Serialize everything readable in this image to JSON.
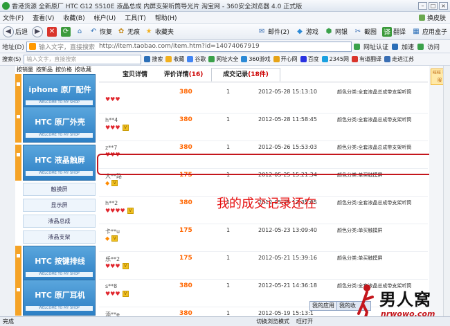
{
  "window": {
    "title": "香港货源 全新原厂 HTC G12 S510E 液晶总成 内屏支架听筒导光片 淘宝网 - 360安全浏览器 4.0 正式版",
    "minimize": "–",
    "maximize": "□",
    "close": "×"
  },
  "menu": {
    "items": [
      "文件(F)",
      "查看(V)",
      "收藏(B)",
      "帐户(U)",
      "工具(T)",
      "帮助(H)"
    ],
    "skin": "换皮肤"
  },
  "toolbar": {
    "back": "后退",
    "restore": "恢复",
    "favorites_none": "无痕",
    "favorites": "收藏夹",
    "mail": "邮件(2)",
    "games": "游戏",
    "netbank": "网银",
    "screenshot": "截图",
    "translate": "翻译",
    "apps": "应用盒子"
  },
  "address": {
    "label": "地址(D)",
    "placeholder": "输入文字，直接搜索",
    "url": "http://item.taobao.com/item.htm?id=14074067919",
    "site_id": "网址认证",
    "speed": "加速",
    "go": "访问"
  },
  "favbar": {
    "label": "搜索(S)",
    "search_btn": "搜索",
    "favs": "收藏",
    "items": [
      "谷歌",
      "网址大全",
      "360游戏",
      "开心网",
      "百度",
      "2345网",
      "有道翻译",
      "走进江苏"
    ]
  },
  "content": {
    "subnav": [
      "按销量",
      "按新品",
      "按价格",
      "按收藏"
    ],
    "categories": [
      {
        "name": "iphone 原厂配件",
        "strip": "WELCOME TO MY SHOP"
      },
      {
        "name": "HTC 原厂外壳",
        "strip": "WELCOME TO MY SHOP"
      },
      {
        "name": "HTC 液晶触屏",
        "strip": "WELCOME TO MY SHOP"
      },
      {
        "name": "HTC 按键排线",
        "strip": "WELCOME TO MY SHOP"
      },
      {
        "name": "HTC 原厂耳机",
        "strip": "WELCOME TO MY SHOP"
      }
    ],
    "subitems": [
      "触摸屏",
      "显示屏",
      "液晶总成",
      "液晶支架"
    ],
    "tabs": {
      "detail": "宝贝详情",
      "reviews": "评价详情",
      "reviews_count": "(16)",
      "records": "成交记录",
      "records_count": "(18件)"
    },
    "records": [
      {
        "buyer": "",
        "price": "380",
        "qty": "1",
        "time": "2012-05-28 15:13:10",
        "spec": "颜色分类:全套液晶总成带支架听筒"
      },
      {
        "buyer": "h**4",
        "price": "380",
        "qty": "1",
        "time": "2012-05-28 11:58:45",
        "spec": "颜色分类:全套液晶总成带支架听筒"
      },
      {
        "buyer": "z**7",
        "price": "380",
        "qty": "1",
        "time": "2012-05-26 15:53:03",
        "spec": "颜色分类:全套液晶总成带支架听筒"
      },
      {
        "buyer": "大**路",
        "price": "175",
        "qty": "1",
        "time": "2012-05-25 15:21:34",
        "spec": "颜色分类:单买触摸屏"
      },
      {
        "buyer": "h**2",
        "price": "380",
        "qty": "1",
        "time": "2012-05-25 12:35:05",
        "spec": "颜色分类:全套液晶总成带支架听筒"
      },
      {
        "buyer": "卡**u",
        "price": "175",
        "qty": "1",
        "time": "2012-05-23 13:09:40",
        "spec": "颜色分类:单买触摸屏"
      },
      {
        "buyer": "乐**2",
        "price": "175",
        "qty": "1",
        "time": "2012-05-21 15:39:16",
        "spec": "颜色分类:单买触摸屏"
      },
      {
        "buyer": "s**8",
        "price": "380",
        "qty": "1",
        "time": "2012-05-21 14:36:18",
        "spec": "颜色分类:全套液晶总成带支架听筒"
      },
      {
        "buyer": "添**e",
        "price": "380",
        "qty": "1",
        "time": "2012-05-19 15:13:1",
        "spec": ""
      }
    ],
    "annotation": "我的成交记录还在",
    "side_ad": "旺旺 客服"
  },
  "popups": {
    "app": "我的应用",
    "more": "我的收"
  },
  "watermark": {
    "brand": "男人窝",
    "url": "nrwowo.com"
  },
  "status": {
    "left": "完成",
    "speed": "切换浏览模式",
    "login": "旺打开"
  }
}
